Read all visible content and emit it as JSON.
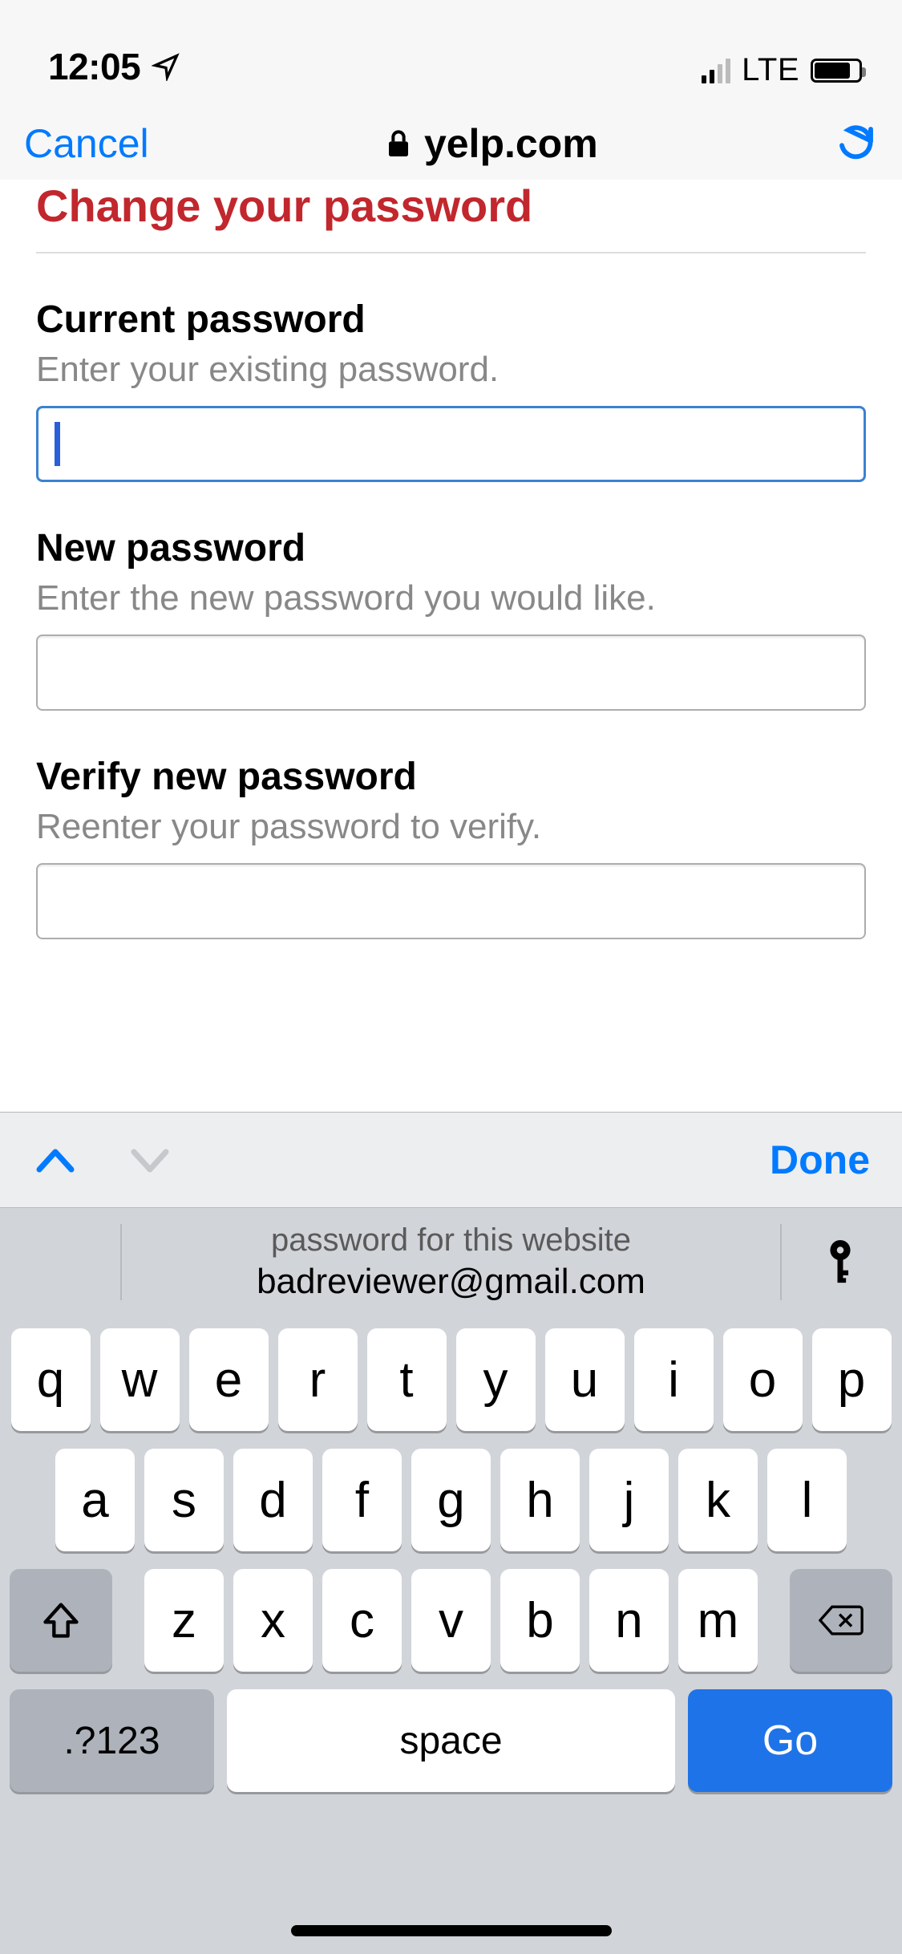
{
  "status": {
    "time": "12:05",
    "network_label": "LTE"
  },
  "browser": {
    "cancel_label": "Cancel",
    "domain": "yelp.com"
  },
  "page": {
    "title": "Change your password",
    "current": {
      "label": "Current password",
      "hint": "Enter your existing password.",
      "value": ""
    },
    "new": {
      "label": "New password",
      "hint": "Enter the new password you would like.",
      "value": ""
    },
    "verify": {
      "label": "Verify new password",
      "hint": "Reenter your password to verify.",
      "value": ""
    }
  },
  "accessory": {
    "done_label": "Done"
  },
  "autofill": {
    "line1": "password for this website",
    "line2": "badreviewer@gmail.com"
  },
  "keyboard": {
    "row1": [
      "q",
      "w",
      "e",
      "r",
      "t",
      "y",
      "u",
      "i",
      "o",
      "p"
    ],
    "row2": [
      "a",
      "s",
      "d",
      "f",
      "g",
      "h",
      "j",
      "k",
      "l"
    ],
    "row3": [
      "z",
      "x",
      "c",
      "v",
      "b",
      "n",
      "m"
    ],
    "numbers_label": ".?123",
    "space_label": "space",
    "go_label": "Go"
  }
}
